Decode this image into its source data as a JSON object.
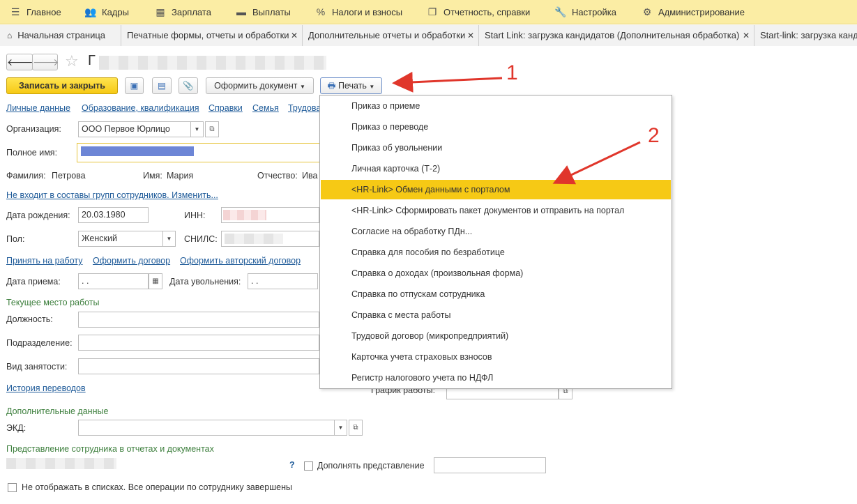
{
  "menu": [
    {
      "label": "Главное",
      "icon": "hamburger-icon",
      "glyph": "☰"
    },
    {
      "label": "Кадры",
      "icon": "users-icon",
      "glyph": "👥"
    },
    {
      "label": "Зарплата",
      "icon": "calculator-icon",
      "glyph": "▦"
    },
    {
      "label": "Выплаты",
      "icon": "wallet-icon",
      "glyph": "▬"
    },
    {
      "label": "Налоги и взносы",
      "icon": "percent-icon",
      "glyph": "%"
    },
    {
      "label": "Отчетность, справки",
      "icon": "reports-icon",
      "glyph": "❐"
    },
    {
      "label": "Настройка",
      "icon": "wrench-icon",
      "glyph": "🔧"
    },
    {
      "label": "Администрирование",
      "icon": "gear-icon",
      "glyph": "⚙"
    }
  ],
  "tabs": [
    {
      "label": "Начальная страница",
      "closable": false
    },
    {
      "label": "Печатные формы, отчеты и обработки",
      "closable": true
    },
    {
      "label": "Дополнительные отчеты и обработки",
      "closable": true
    },
    {
      "label": "Start Link: загрузка кандидатов (Дополнительная обработка)",
      "closable": true
    },
    {
      "label": "Start-link: загрузка канд",
      "closable": false
    }
  ],
  "title": "Г",
  "toolbar": {
    "save_close": "Записать и закрыть",
    "make_document": "Оформить документ",
    "print": "Печать"
  },
  "section_links": [
    "Личные данные",
    "Образование, квалификация",
    "Справки",
    "Семья",
    "Трудова"
  ],
  "form": {
    "org_label": "Организация:",
    "org_value": "ООО Первое Юрлицо",
    "fullname_label": "Полное имя:",
    "surname_label": "Фамилия:",
    "surname_value": "Петрова",
    "name_label": "Имя:",
    "name_value": "Мария",
    "patronymic_label": "Отчество:",
    "patronymic_value": "Ива",
    "groups_link": "Не входит в составы групп сотрудников. Изменить...",
    "birth_label": "Дата рождения:",
    "birth_value": "20.03.1980",
    "inn_label": "ИНН:",
    "sex_label": "Пол:",
    "sex_value": "Женский",
    "snils_label": "СНИЛС:",
    "hire_link": "Принять на работу",
    "contract_link": "Оформить договор",
    "author_contract_link": "Оформить авторский договор",
    "hire_date_label": "Дата приема:",
    "hire_date_value": " .  .",
    "dismiss_date_label": "Дата увольнения:",
    "dismiss_date_value": " .  .",
    "current_job_group": "Текущее место работы",
    "position_label": "Должность:",
    "department_label": "Подразделение:",
    "employment_label": "Вид занятости:",
    "history_link": "История переводов",
    "schedule_label": "График работы:",
    "extra_group": "Дополнительные данные",
    "ekd_label": "ЭКД:",
    "presentation_group": "Представление сотрудника в отчетах и документах",
    "help_mark": "?",
    "supplement_label": "Дополнять представление",
    "hide_label": "Не отображать в списках. Все операции по сотруднику завершены"
  },
  "print_menu": {
    "items": [
      "Приказ о приеме",
      "Приказ о переводе",
      "Приказ об увольнении",
      "Личная карточка (Т-2)",
      "<HR-Link> Обмен данными с порталом",
      "<HR-Link> Сформировать пакет документов и отправить на портал",
      "Согласие на обработку ПДн...",
      "Справка для пособия по безработице",
      "Справка о доходах (произвольная форма)",
      "Справка по отпускам сотрудника",
      "Справка с места работы",
      "Трудовой договор (микропредприятий)",
      "Карточка учета страховых взносов",
      "Регистр налогового учета по НДФЛ"
    ],
    "selected_index": 4
  },
  "annotations": {
    "one": "1",
    "two": "2"
  },
  "colors": {
    "menu_bg": "#fbeda4",
    "accent_yellow": "#f6c915",
    "link": "#1f5b99",
    "group_green": "#3d7f3d",
    "arrow_red": "#e0362b"
  }
}
